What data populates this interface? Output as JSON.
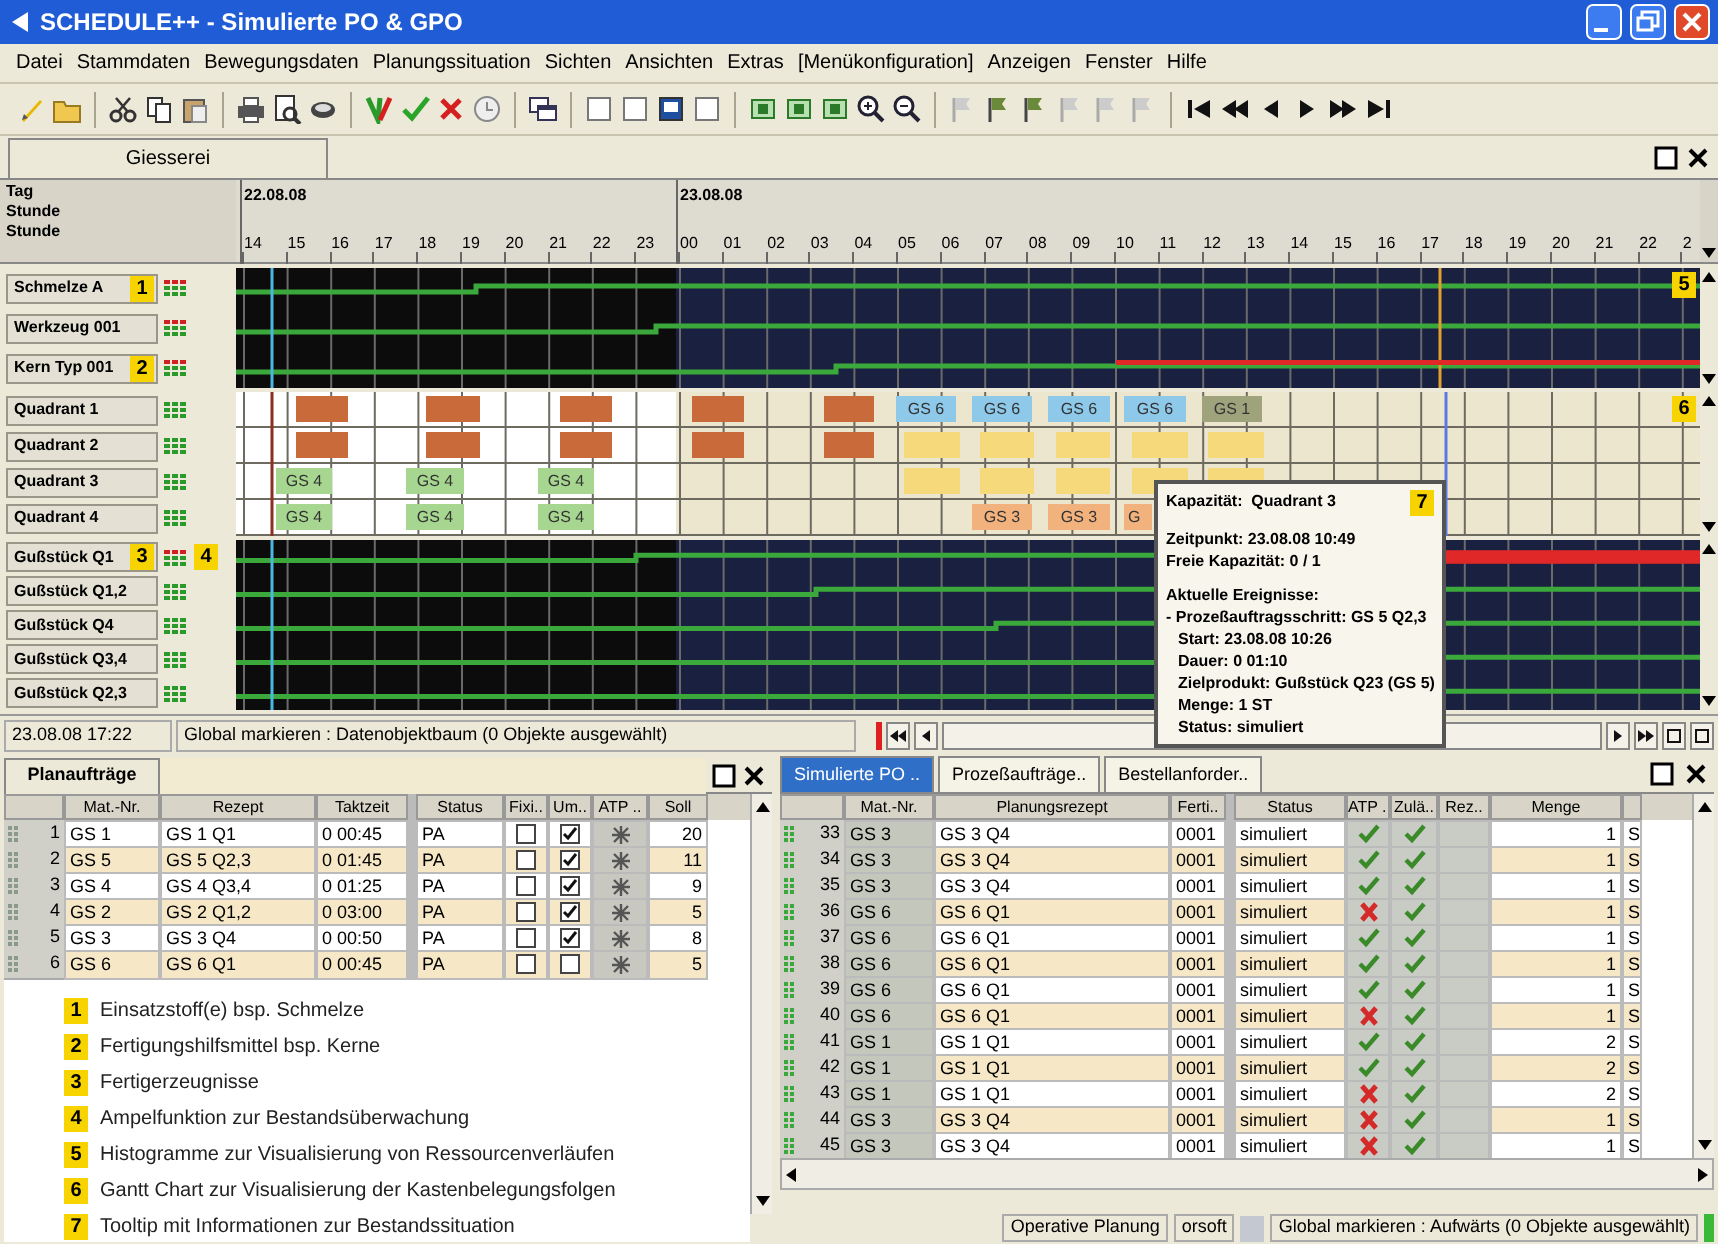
{
  "window": {
    "title": "SCHEDULE++ - Simulierte PO & GPO"
  },
  "menu": [
    "Datei",
    "Stammdaten",
    "Bewegungsdaten",
    "Planungssituation",
    "Sichten",
    "Ansichten",
    "Extras",
    "[Menükonfiguration]",
    "Anzeigen",
    "Fenster",
    "Hilfe"
  ],
  "tab": {
    "label": "Giesserei"
  },
  "timeline": {
    "labels": [
      "Tag",
      "Stunde",
      "Stunde"
    ],
    "days": [
      "22.08.08",
      "23.08.08"
    ],
    "hours": [
      "14",
      "15",
      "16",
      "17",
      "18",
      "19",
      "20",
      "21",
      "22",
      "23",
      "00",
      "01",
      "02",
      "03",
      "04",
      "05",
      "06",
      "07",
      "08",
      "09",
      "10",
      "11",
      "12",
      "13",
      "14",
      "15",
      "16",
      "17",
      "18",
      "19",
      "20",
      "21",
      "22",
      "2"
    ]
  },
  "groups": [
    {
      "kind": "histogram",
      "marker": "5",
      "rows": [
        {
          "name": "Schmelze A",
          "marker": "1",
          "alert": true,
          "shortage": false
        },
        {
          "name": "Werkzeug 001",
          "alert": true,
          "shortage": false
        },
        {
          "name": "Kern Typ 001",
          "marker": "2",
          "alert": true,
          "shortage": true
        }
      ]
    },
    {
      "kind": "gantt",
      "marker": "6",
      "rows": [
        {
          "name": "Quadrant 1",
          "alert": false,
          "bars": [
            {
              "color": "#c96a3a"
            },
            {
              "color": "#c96a3a"
            },
            {
              "color": "#c96a3a"
            },
            {
              "color": "#c96a3a"
            },
            {
              "color": "#c96a3a"
            },
            {
              "color": "#8ec9ea",
              "label": "GS 6"
            },
            {
              "color": "#8ec9ea",
              "label": "GS 6"
            },
            {
              "color": "#8ec9ea",
              "label": "GS 6"
            },
            {
              "color": "#8ec9ea",
              "label": "GS 6"
            },
            {
              "color": "#9ea37c",
              "label": "GS 1"
            }
          ]
        },
        {
          "name": "Quadrant 2",
          "alert": false,
          "bars": [
            {
              "color": "#c96a3a"
            },
            {
              "color": "#c96a3a"
            },
            {
              "color": "#c96a3a"
            },
            {
              "color": "#c96a3a"
            },
            {
              "color": "#c96a3a"
            },
            {
              "color": "#f5d97a"
            },
            {
              "color": "#f5d97a"
            },
            {
              "color": "#f5d97a"
            },
            {
              "color": "#f5d97a"
            },
            {
              "color": "#f5d97a"
            }
          ]
        },
        {
          "name": "Quadrant 3",
          "alert": false,
          "bars": [
            {
              "color": "#a6d68f",
              "label": "GS 4"
            },
            {
              "color": "#a6d68f",
              "label": "GS 4"
            },
            {
              "color": "#a6d68f",
              "label": "GS 4"
            },
            {
              "color": "#f5d97a"
            },
            {
              "color": "#f5d97a"
            },
            {
              "color": "#f5d97a"
            },
            {
              "color": "#f5d97a"
            },
            {
              "color": "#f5d97a"
            }
          ]
        },
        {
          "name": "Quadrant 4",
          "alert": false,
          "bars": [
            {
              "color": "#a6d68f",
              "label": "GS 4"
            },
            {
              "color": "#a6d68f",
              "label": "GS 4"
            },
            {
              "color": "#a6d68f",
              "label": "GS 4"
            },
            {
              "color": "#f2b27e",
              "label": "GS 3"
            },
            {
              "color": "#f2b27e",
              "label": "GS 3"
            },
            {
              "color": "#f2b27e",
              "label": "G"
            }
          ]
        }
      ]
    },
    {
      "kind": "histogram",
      "rows": [
        {
          "name": "Gußstück Q1",
          "marker": "3",
          "signal_marker": "4",
          "alert": true,
          "shortage": true
        },
        {
          "name": "Gußstück Q1,2",
          "alert": false,
          "shortage": false
        },
        {
          "name": "Gußstück Q4",
          "alert": false,
          "shortage": false
        },
        {
          "name": "Gußstück Q3,4",
          "alert": false,
          "shortage": false
        },
        {
          "name": "Gußstück Q2,3",
          "alert": false,
          "shortage": false
        }
      ]
    }
  ],
  "status_line": {
    "time": "23.08.08 17:22",
    "message": "Global markieren : Datenobjektbaum (0 Objekte ausgewählt)"
  },
  "tooltip": {
    "title": "Kapazität:  Quadrant 3",
    "marker": "7",
    "sections": [
      [
        "Zeitpunkt: 23.08.08 10:49",
        "Freie Kapazität: 0 / 1"
      ],
      [
        "Aktuelle Ereignisse:",
        "- Prozeßauftragsschritt: GS 5 Q2,3",
        "Start: 23.08.08 10:26",
        "Dauer: 0 01:10",
        "Zielprodukt: Gußstück Q23 (GS 5)",
        "Menge: 1 ST",
        "Status: simuliert"
      ]
    ]
  },
  "plan_panel": {
    "tab": "Planaufträge",
    "columns": [
      "Mat.-Nr.",
      "Rezept",
      "Taktzeit",
      "Status",
      "Fixi..",
      "Um..",
      "ATP ..",
      "Soll"
    ],
    "rows": [
      {
        "no": "1",
        "mat": "GS 1",
        "rezept": "GS 1 Q1",
        "taktzeit": "0 00:45",
        "status": "PA",
        "fixed": false,
        "um": true,
        "soll": "20"
      },
      {
        "no": "2",
        "mat": "GS 5",
        "rezept": "GS 5 Q2,3",
        "taktzeit": "0 01:45",
        "status": "PA",
        "fixed": false,
        "um": true,
        "soll": "11"
      },
      {
        "no": "3",
        "mat": "GS 4",
        "rezept": "GS 4 Q3,4",
        "taktzeit": "0 01:25",
        "status": "PA",
        "fixed": false,
        "um": true,
        "soll": "9"
      },
      {
        "no": "4",
        "mat": "GS 2",
        "rezept": "GS 2 Q1,2",
        "taktzeit": "0 03:00",
        "status": "PA",
        "fixed": false,
        "um": true,
        "soll": "5"
      },
      {
        "no": "5",
        "mat": "GS 3",
        "rezept": "GS 3 Q4",
        "taktzeit": "0 00:50",
        "status": "PA",
        "fixed": false,
        "um": true,
        "soll": "8"
      },
      {
        "no": "6",
        "mat": "GS 6",
        "rezept": "GS 6 Q1",
        "taktzeit": "0 00:45",
        "status": "PA",
        "fixed": false,
        "um": false,
        "soll": "5"
      }
    ]
  },
  "legend": [
    {
      "marker": "1",
      "text": "Einsatzstoff(e) bsp. Schmelze"
    },
    {
      "marker": "2",
      "text": "Fertigungshilfsmittel bsp. Kerne"
    },
    {
      "marker": "3",
      "text": "Fertigerzeugnisse"
    },
    {
      "marker": "4",
      "text": "Ampelfunktion zur Bestandsüberwachung"
    },
    {
      "marker": "5",
      "text": "Histogramme zur Visualisierung von Ressourcenverläufen"
    },
    {
      "marker": "6",
      "text": "Gantt Chart zur Visualisierung der Kastenbelegungsfolgen"
    },
    {
      "marker": "7",
      "text": "Tooltip mit Informationen zur Bestandssituation"
    }
  ],
  "po_panel": {
    "tabs": [
      {
        "label": "Simulierte PO ..",
        "selected": true
      },
      {
        "label": "Prozeßaufträge..",
        "selected": false
      },
      {
        "label": "Bestellanforder..",
        "selected": false
      }
    ],
    "columns": [
      "Mat.-Nr.",
      "Planungsrezept",
      "Ferti..",
      "Status",
      "ATP ..",
      "Zulä..",
      "Rez..",
      "Menge"
    ],
    "rows": [
      {
        "no": "33",
        "mat": "GS 3",
        "rezept": "GS 3 Q4",
        "ferti": "0001",
        "status": "simuliert",
        "atp": true,
        "zul": true,
        "menge": "1",
        "column_10": "S"
      },
      {
        "no": "34",
        "mat": "GS 3",
        "rezept": "GS 3 Q4",
        "ferti": "0001",
        "status": "simuliert",
        "atp": true,
        "zul": true,
        "menge": "1",
        "column_10": "S"
      },
      {
        "no": "35",
        "mat": "GS 3",
        "rezept": "GS 3 Q4",
        "ferti": "0001",
        "status": "simuliert",
        "atp": true,
        "zul": true,
        "menge": "1",
        "column_10": "S"
      },
      {
        "no": "36",
        "mat": "GS 6",
        "rezept": "GS 6 Q1",
        "ferti": "0001",
        "status": "simuliert",
        "atp": false,
        "zul": true,
        "menge": "1",
        "column_10": "S"
      },
      {
        "no": "37",
        "mat": "GS 6",
        "rezept": "GS 6 Q1",
        "ferti": "0001",
        "status": "simuliert",
        "atp": true,
        "zul": true,
        "menge": "1",
        "column_10": "S"
      },
      {
        "no": "38",
        "mat": "GS 6",
        "rezept": "GS 6 Q1",
        "ferti": "0001",
        "status": "simuliert",
        "atp": true,
        "zul": true,
        "menge": "1",
        "column_10": "S"
      },
      {
        "no": "39",
        "mat": "GS 6",
        "rezept": "GS 6 Q1",
        "ferti": "0001",
        "status": "simuliert",
        "atp": true,
        "zul": true,
        "menge": "1",
        "column_10": "S"
      },
      {
        "no": "40",
        "mat": "GS 6",
        "rezept": "GS 6 Q1",
        "ferti": "0001",
        "status": "simuliert",
        "atp": false,
        "zul": true,
        "menge": "1",
        "column_10": "S"
      },
      {
        "no": "41",
        "mat": "GS 1",
        "rezept": "GS 1 Q1",
        "ferti": "0001",
        "status": "simuliert",
        "atp": true,
        "zul": true,
        "menge": "2",
        "column_10": "S"
      },
      {
        "no": "42",
        "mat": "GS 1",
        "rezept": "GS 1 Q1",
        "ferti": "0001",
        "status": "simuliert",
        "atp": true,
        "zul": true,
        "menge": "2",
        "column_10": "S"
      },
      {
        "no": "43",
        "mat": "GS 1",
        "rezept": "GS 1 Q1",
        "ferti": "0001",
        "status": "simuliert",
        "atp": false,
        "zul": true,
        "menge": "2",
        "column_10": "S"
      },
      {
        "no": "44",
        "mat": "GS 3",
        "rezept": "GS 3 Q4",
        "ferti": "0001",
        "status": "simuliert",
        "atp": false,
        "zul": true,
        "menge": "1",
        "column_10": "S"
      },
      {
        "no": "45",
        "mat": "GS 3",
        "rezept": "GS 3 Q4",
        "ferti": "0001",
        "status": "simuliert",
        "atp": false,
        "zul": true,
        "menge": "1",
        "column_10": "S"
      }
    ]
  },
  "status_bar": [
    "Operative Planung",
    "orsoft",
    "Global markieren : Aufwärts (0 Objekte ausgewählt)"
  ]
}
